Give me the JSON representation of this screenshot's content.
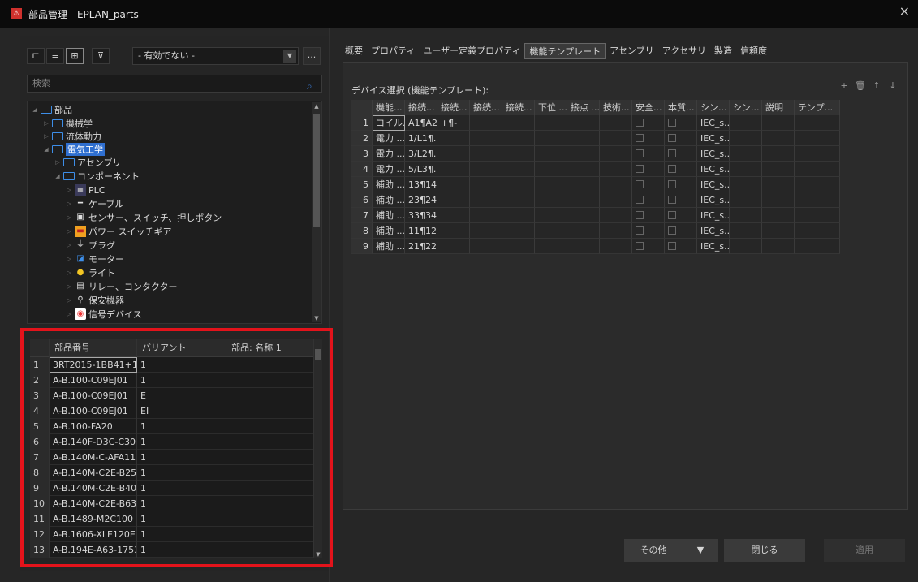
{
  "window": {
    "title": "部品管理 - EPLAN_parts",
    "close": "×"
  },
  "toolbar": {
    "filter_value": "- 有効でない -",
    "more": "..."
  },
  "search": {
    "placeholder": "検索"
  },
  "tree": {
    "items": [
      {
        "label": "部品",
        "level": 0,
        "expanded": true,
        "icon": "folder-icon"
      },
      {
        "label": "機械学",
        "level": 1,
        "expanded": false,
        "icon": "folder-icon"
      },
      {
        "label": "流体動力",
        "level": 1,
        "expanded": false,
        "icon": "folder-icon"
      },
      {
        "label": "電気工学",
        "level": 1,
        "expanded": true,
        "icon": "folder-icon",
        "selected": true
      },
      {
        "label": "アセンブリ",
        "level": 2,
        "expanded": false,
        "icon": "folder-icon"
      },
      {
        "label": "コンポーネント",
        "level": 2,
        "expanded": true,
        "icon": "folder-icon"
      },
      {
        "label": "PLC",
        "level": 3,
        "icon": "plc-icon"
      },
      {
        "label": "ケーブル",
        "level": 3,
        "icon": "cable-icon"
      },
      {
        "label": "センサー、スイッチ、押しボタン",
        "level": 3,
        "icon": "sensor-icon"
      },
      {
        "label": "パワー スイッチギア",
        "level": 3,
        "icon": "power-switchgear-icon"
      },
      {
        "label": "プラグ",
        "level": 3,
        "icon": "plug-icon"
      },
      {
        "label": "モーター",
        "level": 3,
        "icon": "motor-icon"
      },
      {
        "label": "ライト",
        "level": 3,
        "icon": "light-icon"
      },
      {
        "label": "リレー、コンタクター",
        "level": 3,
        "icon": "relay-icon"
      },
      {
        "label": "保安機器",
        "level": 3,
        "icon": "safety-device-icon"
      },
      {
        "label": "信号デバイス",
        "level": 3,
        "icon": "signal-device-icon"
      }
    ]
  },
  "parts": {
    "headers": [
      "部品番号",
      "バリアント",
      "部品: 名称 1"
    ],
    "rows": [
      {
        "n": "1",
        "part": "3RT2015-1BB41+1...",
        "variant": "1",
        "name": ""
      },
      {
        "n": "2",
        "part": "A-B.100-C09EJ01",
        "variant": "1",
        "name": ""
      },
      {
        "n": "3",
        "part": "A-B.100-C09EJ01",
        "variant": "E",
        "name": ""
      },
      {
        "n": "4",
        "part": "A-B.100-C09EJ01",
        "variant": "EI",
        "name": ""
      },
      {
        "n": "5",
        "part": "A-B.100-FA20",
        "variant": "1",
        "name": ""
      },
      {
        "n": "6",
        "part": "A-B.140F-D3C-C30",
        "variant": "1",
        "name": ""
      },
      {
        "n": "7",
        "part": "A-B.140M-C-AFA11",
        "variant": "1",
        "name": ""
      },
      {
        "n": "8",
        "part": "A-B.140M-C2E-B25",
        "variant": "1",
        "name": ""
      },
      {
        "n": "9",
        "part": "A-B.140M-C2E-B40",
        "variant": "1",
        "name": ""
      },
      {
        "n": "10",
        "part": "A-B.140M-C2E-B63",
        "variant": "1",
        "name": ""
      },
      {
        "n": "11",
        "part": "A-B.1489-M2C100",
        "variant": "1",
        "name": ""
      },
      {
        "n": "12",
        "part": "A-B.1606-XLE120E...",
        "variant": "1",
        "name": ""
      },
      {
        "n": "13",
        "part": "A-B.194E-A63-1753",
        "variant": "1",
        "name": ""
      }
    ]
  },
  "tabs": [
    "概要",
    "プロパティ",
    "ユーザー定義プロパティ",
    "機能テンプレート",
    "アセンブリ",
    "アクセサリ",
    "製造",
    "信頼度"
  ],
  "active_tab": "機能テンプレート",
  "section_label": "デバイス選択 (機能テンプレート):",
  "mini_tools": [
    "+",
    "🗑",
    "↑",
    "↓"
  ],
  "functions": {
    "headers": [
      "機能...",
      "接続...",
      "接続...",
      "接続...",
      "接続...",
      "下位 ...",
      "接点 ...",
      "技術...",
      "安全...",
      "本質...",
      "シン...",
      "シン...",
      "説明",
      "テンプ..."
    ],
    "rows": [
      {
        "n": "1",
        "func": "コイル...",
        "conn1": "A1¶A2",
        "conn2": "+¶-",
        "sym": "IEC_s..."
      },
      {
        "n": "2",
        "func": "電力 ...",
        "conn1": "1/L1¶...",
        "conn2": "",
        "sym": "IEC_s..."
      },
      {
        "n": "3",
        "func": "電力 ...",
        "conn1": "3/L2¶...",
        "conn2": "",
        "sym": "IEC_s..."
      },
      {
        "n": "4",
        "func": "電力 ...",
        "conn1": "5/L3¶...",
        "conn2": "",
        "sym": "IEC_s..."
      },
      {
        "n": "5",
        "func": "補助 ...",
        "conn1": "13¶14",
        "conn2": "",
        "sym": "IEC_s..."
      },
      {
        "n": "6",
        "func": "補助 ...",
        "conn1": "23¶24",
        "conn2": "",
        "sym": "IEC_s..."
      },
      {
        "n": "7",
        "func": "補助 ...",
        "conn1": "33¶34",
        "conn2": "",
        "sym": "IEC_s..."
      },
      {
        "n": "8",
        "func": "補助 ...",
        "conn1": "11¶12",
        "conn2": "",
        "sym": "IEC_s..."
      },
      {
        "n": "9",
        "func": "補助 ...",
        "conn1": "21¶22",
        "conn2": "",
        "sym": "IEC_s..."
      }
    ]
  },
  "buttons": {
    "other": "その他",
    "close": "閉じる",
    "apply": "適用"
  },
  "colors": {
    "highlight_box": "#e3131b",
    "selection": "#2f6fd0",
    "folder": "#3d8ee8"
  }
}
